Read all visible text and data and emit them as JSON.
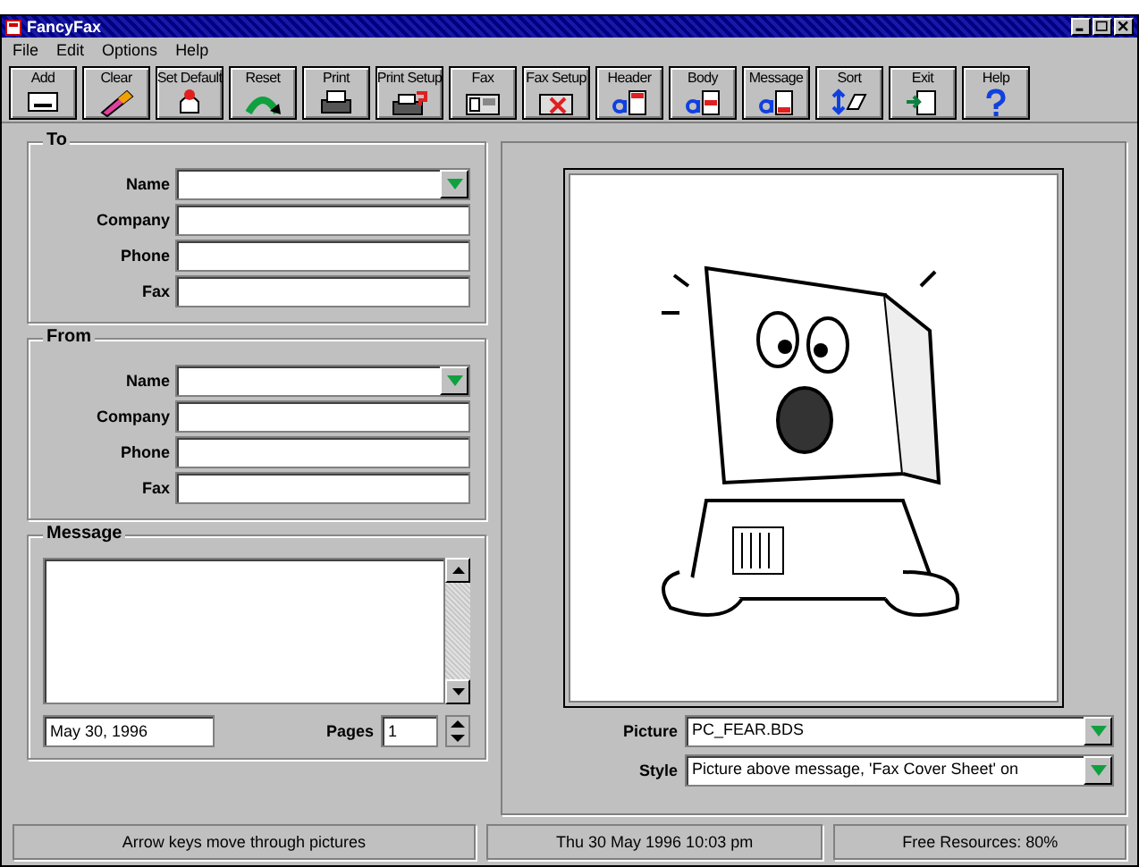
{
  "window": {
    "title": "FancyFax"
  },
  "menu": [
    "File",
    "Edit",
    "Options",
    "Help"
  ],
  "toolbar": [
    {
      "label": "Add"
    },
    {
      "label": "Clear"
    },
    {
      "label": "Set Default"
    },
    {
      "label": "Reset"
    },
    {
      "label": "Print"
    },
    {
      "label": "Print Setup"
    },
    {
      "label": "Fax"
    },
    {
      "label": "Fax Setup"
    },
    {
      "label": "Header"
    },
    {
      "label": "Body"
    },
    {
      "label": "Message"
    },
    {
      "label": "Sort"
    },
    {
      "label": "Exit"
    },
    {
      "label": "Help"
    }
  ],
  "to": {
    "title": "To",
    "fields": [
      {
        "label": "Name",
        "kind": "dropdown"
      },
      {
        "label": "Company",
        "kind": "text"
      },
      {
        "label": "Phone",
        "kind": "text"
      },
      {
        "label": "Fax",
        "kind": "text"
      }
    ]
  },
  "from": {
    "title": "From",
    "fields": [
      {
        "label": "Name",
        "kind": "dropdown"
      },
      {
        "label": "Company",
        "kind": "text"
      },
      {
        "label": "Phone",
        "kind": "text"
      },
      {
        "label": "Fax",
        "kind": "text"
      }
    ]
  },
  "message": {
    "title": "Message",
    "date": "May 30, 1996",
    "pages_label": "Pages",
    "pages": "1"
  },
  "picture": {
    "label": "Picture",
    "value": "PC_FEAR.BDS"
  },
  "style": {
    "label": "Style",
    "value": "Picture above message, 'Fax Cover Sheet' on"
  },
  "status_bar": [
    "Arrow keys move through pictures",
    "Thu 30 May 1996 10:03 pm",
    "Free Resources: 80%"
  ]
}
